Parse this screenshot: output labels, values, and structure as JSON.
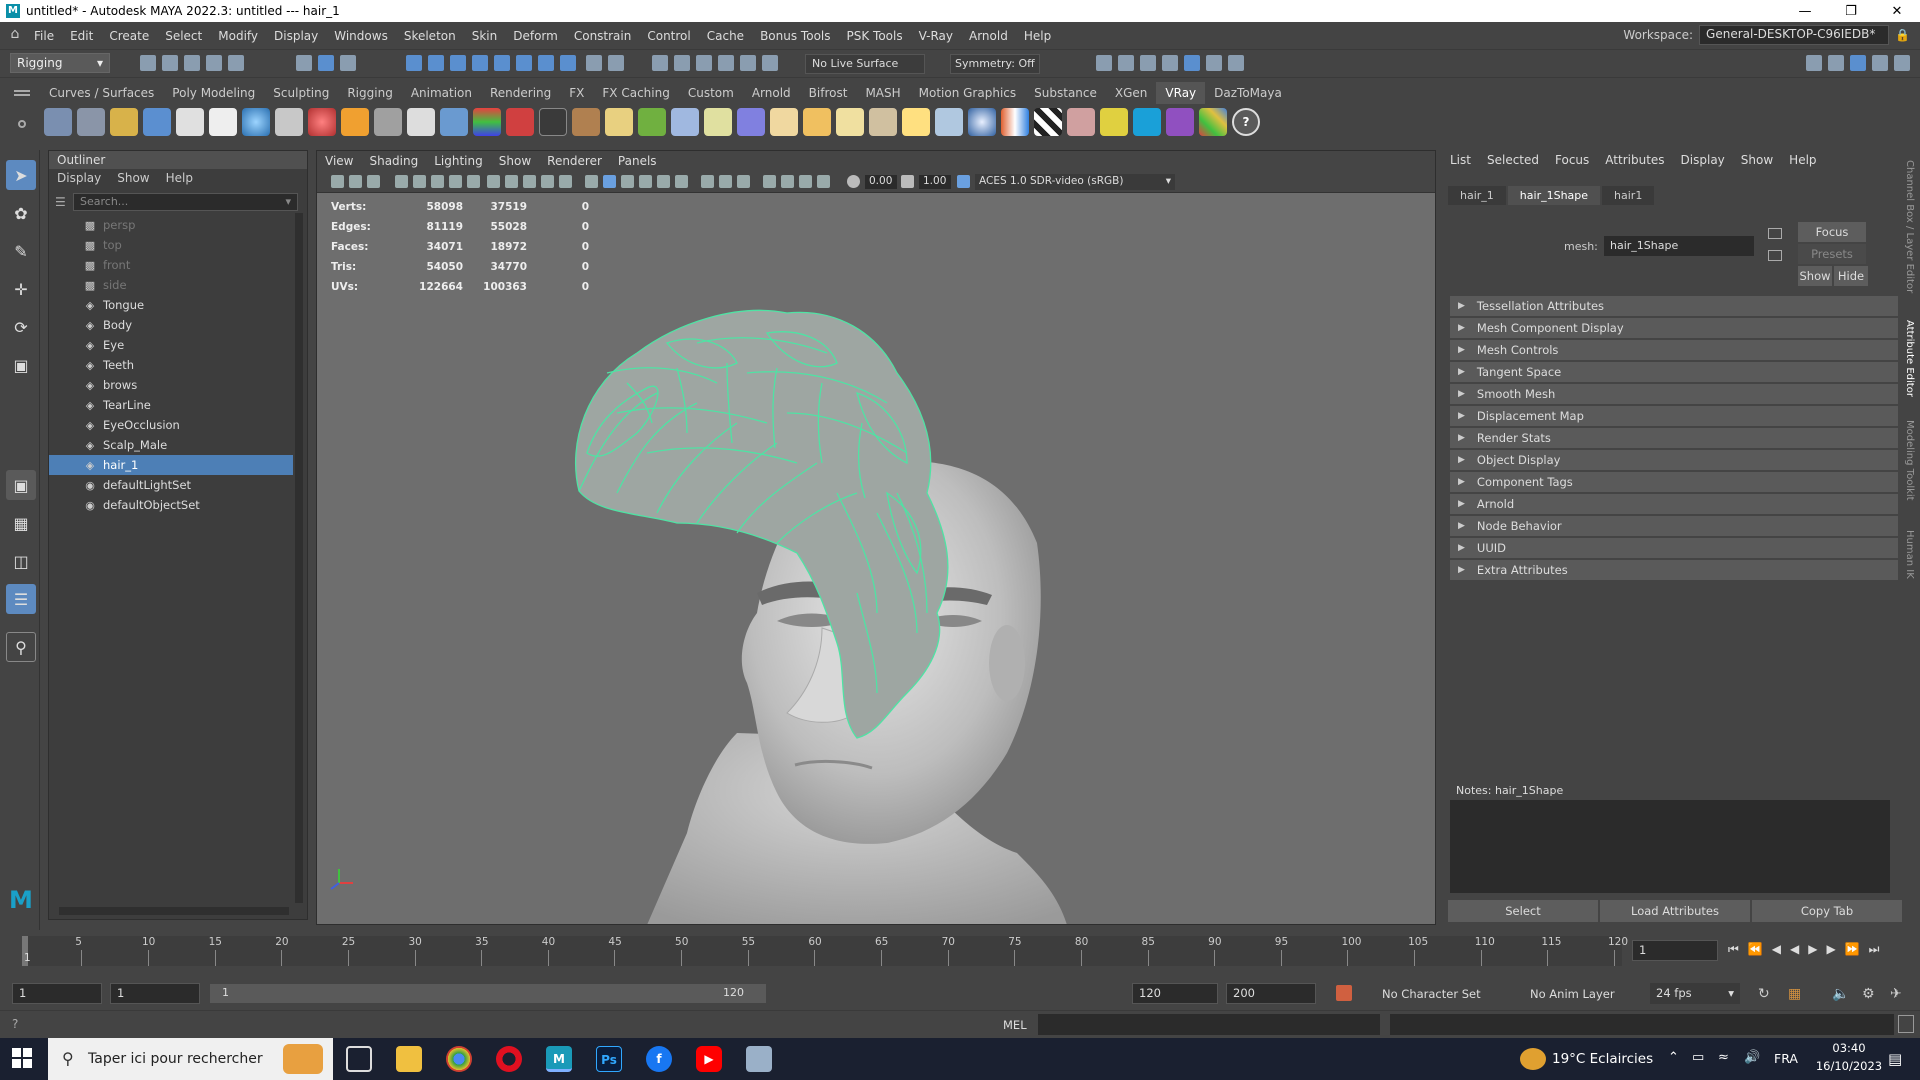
{
  "window": {
    "title": "untitled* - Autodesk MAYA 2022.3: untitled  ---  hair_1"
  },
  "menubar": {
    "items": [
      "File",
      "Edit",
      "Create",
      "Select",
      "Modify",
      "Display",
      "Windows",
      "Skeleton",
      "Skin",
      "Deform",
      "Constrain",
      "Control",
      "Cache",
      "Bonus Tools",
      "PSK Tools",
      "V-Ray",
      "Arnold",
      "Help"
    ],
    "workspace_label": "Workspace:",
    "workspace_value": "General-DESKTOP-C96IEDB*"
  },
  "statusline": {
    "mode": "Rigging",
    "live_surface": "No Live Surface",
    "symmetry": "Symmetry: Off"
  },
  "shelf": {
    "tabs": [
      "Curves / Surfaces",
      "Poly Modeling",
      "Sculpting",
      "Rigging",
      "Animation",
      "Rendering",
      "FX",
      "FX Caching",
      "Custom",
      "Arnold",
      "Bifrost",
      "MASH",
      "Motion Graphics",
      "Substance",
      "XGen",
      "VRay",
      "DazToMaya"
    ],
    "active_tab": "VRay"
  },
  "outliner": {
    "title": "Outliner",
    "menu": [
      "Display",
      "Show",
      "Help"
    ],
    "search_placeholder": "Search...",
    "items": [
      {
        "name": "persp",
        "icon": "camera-icon",
        "dim": true
      },
      {
        "name": "top",
        "icon": "camera-icon",
        "dim": true
      },
      {
        "name": "front",
        "icon": "camera-icon",
        "dim": true
      },
      {
        "name": "side",
        "icon": "camera-icon",
        "dim": true
      },
      {
        "name": "Tongue",
        "icon": "mesh-icon"
      },
      {
        "name": "Body",
        "icon": "mesh-icon"
      },
      {
        "name": "Eye",
        "icon": "mesh-icon"
      },
      {
        "name": "Teeth",
        "icon": "mesh-icon"
      },
      {
        "name": "brows",
        "icon": "mesh-icon"
      },
      {
        "name": "TearLine",
        "icon": "mesh-icon"
      },
      {
        "name": "EyeOcclusion",
        "icon": "mesh-icon"
      },
      {
        "name": "Scalp_Male",
        "icon": "mesh-icon"
      },
      {
        "name": "hair_1",
        "icon": "mesh-icon",
        "selected": true
      },
      {
        "name": "defaultLightSet",
        "icon": "set-icon"
      },
      {
        "name": "defaultObjectSet",
        "icon": "set-icon"
      }
    ]
  },
  "viewport": {
    "menu": [
      "View",
      "Shading",
      "Lighting",
      "Show",
      "Renderer",
      "Panels"
    ],
    "exposure": "0.00",
    "gamma": "1.00",
    "colorspace": "ACES 1.0 SDR-video (sRGB)",
    "hud": [
      {
        "label": "Verts:",
        "a": "58098",
        "b": "37519",
        "c": "0"
      },
      {
        "label": "Edges:",
        "a": "81119",
        "b": "55028",
        "c": "0"
      },
      {
        "label": "Faces:",
        "a": "34071",
        "b": "18972",
        "c": "0"
      },
      {
        "label": "Tris:",
        "a": "54050",
        "b": "34770",
        "c": "0"
      },
      {
        "label": "UVs:",
        "a": "122664",
        "b": "100363",
        "c": "0"
      }
    ]
  },
  "attribute_editor": {
    "menu": [
      "List",
      "Selected",
      "Focus",
      "Attributes",
      "Display",
      "Show",
      "Help"
    ],
    "tabs": [
      "hair_1",
      "hair_1Shape",
      "hair1"
    ],
    "active_tab": "hair_1Shape",
    "mesh_label": "mesh:",
    "mesh_value": "hair_1Shape",
    "focus_btn": "Focus",
    "presets_btn": "Presets",
    "show_btn": "Show",
    "hide_btn": "Hide",
    "sections": [
      "Tessellation Attributes",
      "Mesh Component Display",
      "Mesh Controls",
      "Tangent Space",
      "Smooth Mesh",
      "Displacement Map",
      "Render Stats",
      "Object Display",
      "Component Tags",
      "Arnold",
      "Node Behavior",
      "UUID",
      "Extra Attributes"
    ],
    "notes_label": "Notes:  hair_1Shape",
    "bottom_buttons": [
      "Select",
      "Load Attributes",
      "Copy Tab"
    ],
    "side_tabs": [
      "Channel Box / Layer Editor",
      "Attribute Editor",
      "Modeling Toolkit",
      "Human IK"
    ]
  },
  "timeline": {
    "ticks": [
      "5",
      "10",
      "15",
      "20",
      "25",
      "30",
      "35",
      "40",
      "45",
      "50",
      "55",
      "60",
      "65",
      "70",
      "75",
      "80",
      "85",
      "90",
      "95",
      "100",
      "105",
      "110",
      "115",
      "120"
    ],
    "current_frame_marker": "1",
    "current_frame": "1"
  },
  "range": {
    "start": "1",
    "playback_start": "1",
    "slider_start": "1",
    "slider_end": "120",
    "playback_end": "120",
    "end": "200",
    "character_set": "No Character Set",
    "anim_layer": "No Anim Layer",
    "fps": "24 fps"
  },
  "cmdline": {
    "lang": "MEL"
  },
  "taskbar": {
    "search_text": "Taper ici pour rechercher",
    "weather": "19°C  Eclaircies",
    "lang": "FRA",
    "time": "03:40",
    "date": "16/10/2023"
  },
  "colors": {
    "accent": "#4d7fb6",
    "wireframe": "#4fe3a4"
  }
}
